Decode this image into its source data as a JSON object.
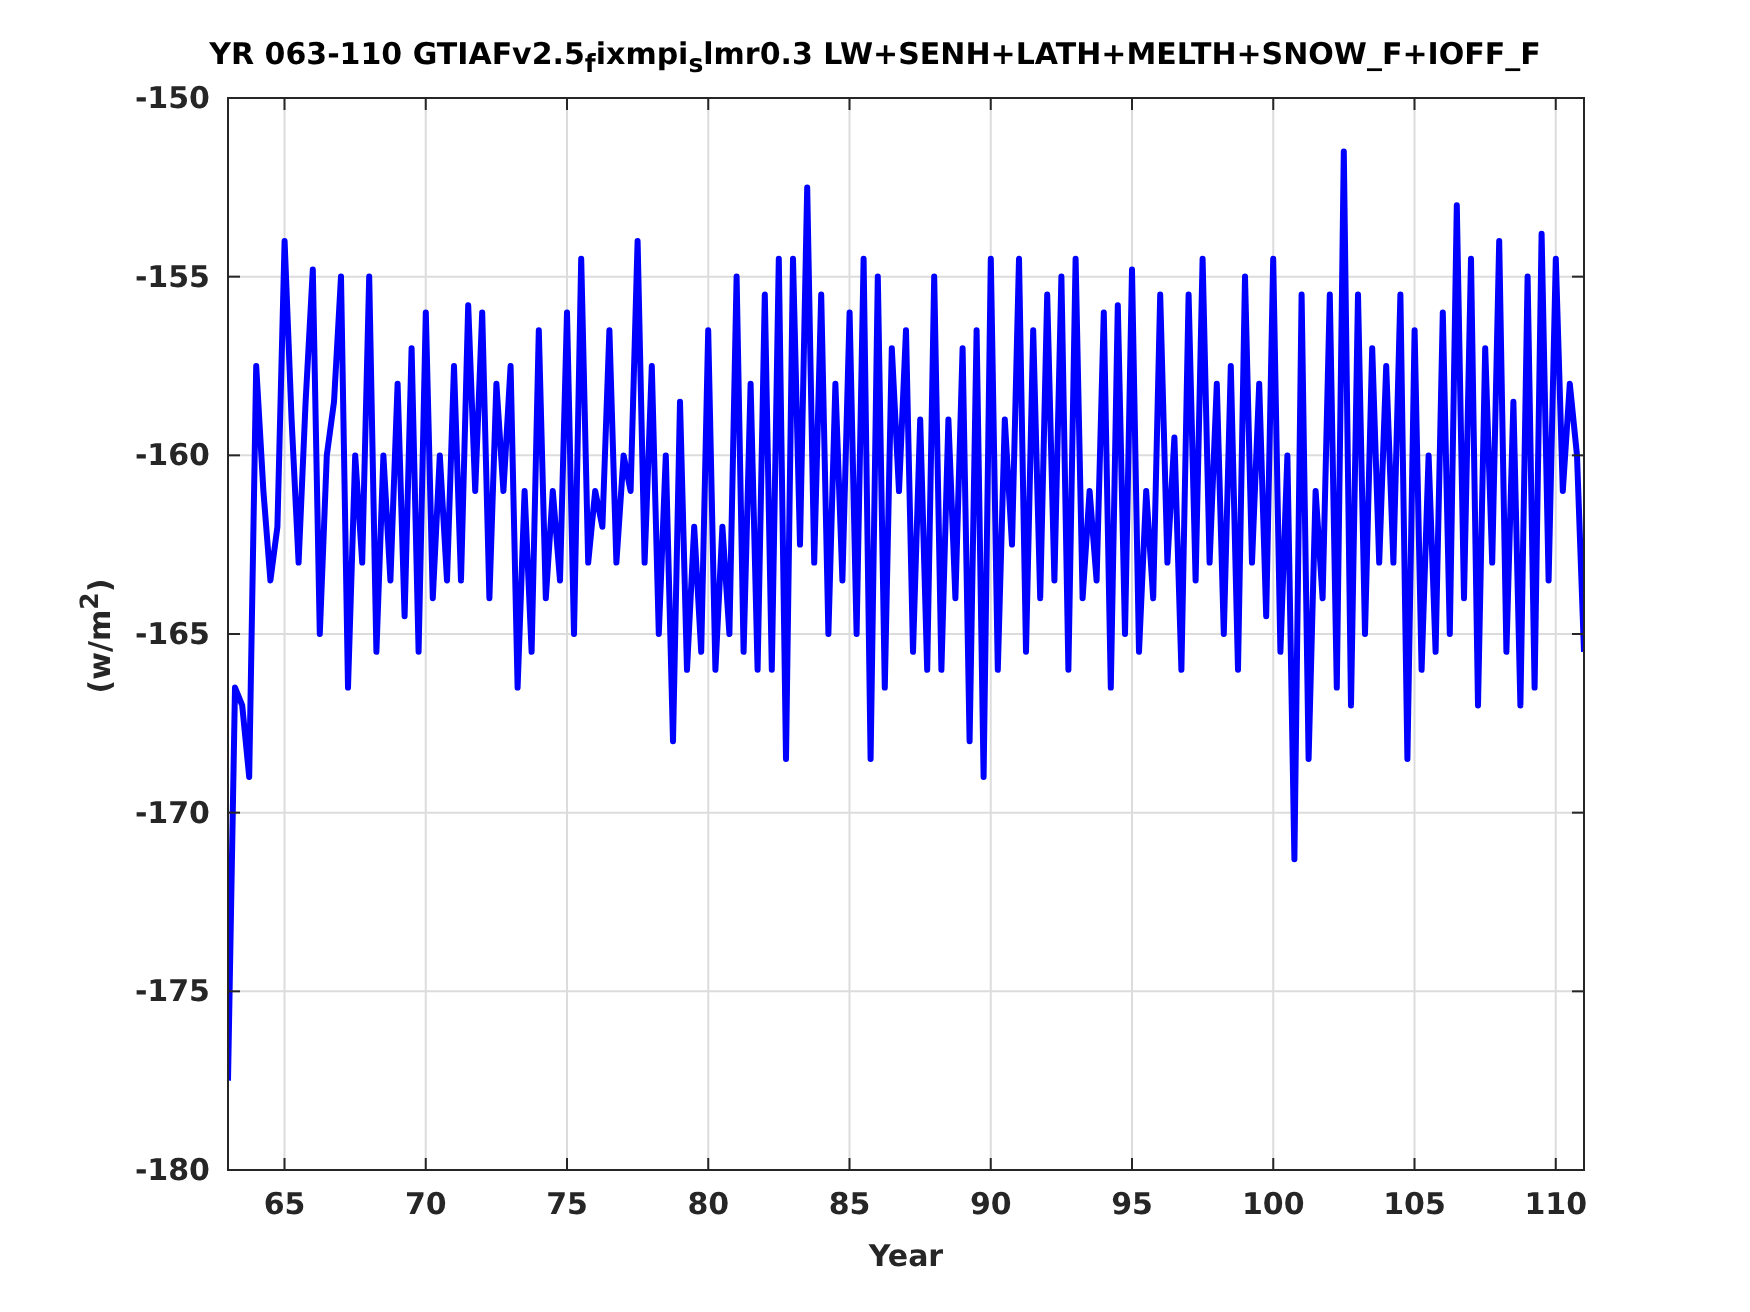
{
  "figure": {
    "chart_data": {
      "type": "line",
      "title": "YR 063-110 GTIAFv2.5$_{f}$ixmpi$_{s}$lmr0.3 LW+SENH+LATH+MELTH+SNOW_F+IOFF_F",
      "xlabel": "Year",
      "ylabel": "(w/m$^{2}$)",
      "x": [
        63,
        63.25,
        63.5,
        63.75,
        64,
        64.25,
        64.5,
        64.75,
        65,
        65.25,
        65.5,
        65.75,
        66,
        66.25,
        66.5,
        66.75,
        67,
        67.25,
        67.5,
        67.75,
        68,
        68.25,
        68.5,
        68.75,
        69,
        69.25,
        69.5,
        69.75,
        70,
        70.25,
        70.5,
        70.75,
        71,
        71.25,
        71.5,
        71.75,
        72,
        72.25,
        72.5,
        72.75,
        73,
        73.25,
        73.5,
        73.75,
        74,
        74.25,
        74.5,
        74.75,
        75,
        75.25,
        75.5,
        75.75,
        76,
        76.25,
        76.5,
        76.75,
        77,
        77.25,
        77.5,
        77.75,
        78,
        78.25,
        78.5,
        78.75,
        79,
        79.25,
        79.5,
        79.75,
        80,
        80.25,
        80.5,
        80.75,
        81,
        81.25,
        81.5,
        81.75,
        82,
        82.25,
        82.5,
        82.75,
        83,
        83.25,
        83.5,
        83.75,
        84,
        84.25,
        84.5,
        84.75,
        85,
        85.25,
        85.5,
        85.75,
        86,
        86.25,
        86.5,
        86.75,
        87,
        87.25,
        87.5,
        87.75,
        88,
        88.25,
        88.5,
        88.75,
        89,
        89.25,
        89.5,
        89.75,
        90,
        90.25,
        90.5,
        90.75,
        91,
        91.25,
        91.5,
        91.75,
        92,
        92.25,
        92.5,
        92.75,
        93,
        93.25,
        93.5,
        93.75,
        94,
        94.25,
        94.5,
        94.75,
        95,
        95.25,
        95.5,
        95.75,
        96,
        96.25,
        96.5,
        96.75,
        97,
        97.25,
        97.5,
        97.75,
        98,
        98.25,
        98.5,
        98.75,
        99,
        99.25,
        99.5,
        99.75,
        100,
        100.25,
        100.5,
        100.75,
        101,
        101.25,
        101.5,
        101.75,
        102,
        102.25,
        102.5,
        102.75,
        103,
        103.25,
        103.5,
        103.75,
        104,
        104.25,
        104.5,
        104.75,
        105,
        105.25,
        105.5,
        105.75,
        106,
        106.25,
        106.5,
        106.75,
        107,
        107.25,
        107.5,
        107.75,
        108,
        108.25,
        108.5,
        108.75,
        109,
        109.25,
        109.5,
        109.75,
        110,
        110.25,
        110.5,
        110.75,
        111
      ],
      "series": [
        {
          "color": "#0000ff",
          "values": [
            -177.5,
            -166.5,
            -167,
            -169,
            -157.5,
            -161,
            -163.5,
            -162,
            -154,
            -159,
            -163,
            -158.5,
            -154.8,
            -165,
            -160,
            -158.5,
            -155,
            -166.5,
            -160,
            -163,
            -155,
            -165.5,
            -160,
            -163.5,
            -158,
            -164.5,
            -157,
            -165.5,
            -156,
            -164,
            -160,
            -163.5,
            -157.5,
            -163.5,
            -155.8,
            -161,
            -156,
            -164,
            -158,
            -161,
            -157.5,
            -166.5,
            -161,
            -165.5,
            -156.5,
            -164,
            -161,
            -163.5,
            -156,
            -165,
            -154.5,
            -163,
            -161,
            -162,
            -156.5,
            -163,
            -160,
            -161,
            -154,
            -163,
            -157.5,
            -165,
            -160,
            -168,
            -158.5,
            -166,
            -162,
            -165.5,
            -156.5,
            -166,
            -162,
            -165,
            -155,
            -165.5,
            -158,
            -166,
            -155.5,
            -166,
            -154.5,
            -168.5,
            -154.5,
            -162.5,
            -152.5,
            -163,
            -155.5,
            -165,
            -158,
            -163.5,
            -156,
            -165,
            -154.5,
            -168.5,
            -155,
            -166.5,
            -157,
            -161,
            -156.5,
            -165.5,
            -159,
            -166,
            -155,
            -166,
            -159,
            -164,
            -157,
            -168,
            -156.5,
            -169,
            -154.5,
            -166,
            -159,
            -162.5,
            -154.5,
            -165.5,
            -156.5,
            -164,
            -155.5,
            -163.5,
            -155,
            -166,
            -154.5,
            -164,
            -161,
            -163.5,
            -156,
            -166.5,
            -155.8,
            -165,
            -154.8,
            -165.5,
            -161,
            -164,
            -155.5,
            -163,
            -159.5,
            -166,
            -155.5,
            -163.5,
            -154.5,
            -163,
            -158,
            -165,
            -157.5,
            -166,
            -155,
            -163,
            -158,
            -164.5,
            -154.5,
            -165.5,
            -160,
            -171.3,
            -155.5,
            -168.5,
            -161,
            -164,
            -155.5,
            -166.5,
            -151.5,
            -167,
            -155.5,
            -165,
            -157,
            -163,
            -157.5,
            -163,
            -155.5,
            -168.5,
            -156.5,
            -166,
            -160,
            -165.5,
            -156,
            -165,
            -153,
            -164,
            -154.5,
            -167,
            -157,
            -163,
            -154,
            -165.5,
            -158.5,
            -167,
            -155,
            -166.5,
            -153.8,
            -163.5,
            -154.5,
            -161,
            -158,
            -160,
            -165.5
          ]
        }
      ],
      "grid": true,
      "xlim": [
        63,
        111
      ],
      "ylim": [
        -180,
        -150
      ],
      "xticks": [
        65,
        70,
        75,
        80,
        85,
        90,
        95,
        100,
        105,
        110
      ],
      "yticks": [
        -180,
        -175,
        -170,
        -165,
        -160,
        -155,
        -150
      ]
    }
  }
}
